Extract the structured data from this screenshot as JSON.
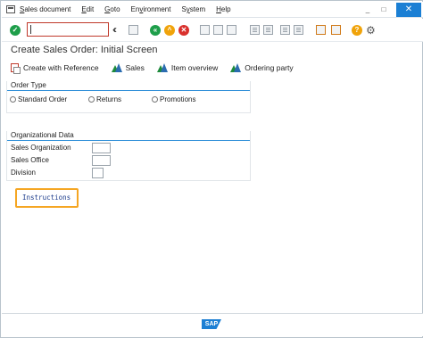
{
  "menubar": {
    "items": [
      "Sales document",
      "Edit",
      "Goto",
      "Environment",
      "System",
      "Help"
    ],
    "mnemonics": [
      "S",
      "E",
      "G",
      "v",
      "y",
      "H"
    ]
  },
  "window": {
    "minimize_glyph": "_",
    "restore_glyph": "□",
    "close_glyph": "✕"
  },
  "toolbar": {
    "command_value": "",
    "icons": [
      "enter-icon",
      "command-field",
      "back-arrows-icon",
      "save-icon",
      "back-icon",
      "exit-icon",
      "cancel-icon",
      "print-icon",
      "find-icon",
      "find-next-icon",
      "first-page-icon",
      "previous-page-icon",
      "next-page-icon",
      "last-page-icon",
      "new-session-icon",
      "shortcut-icon",
      "help-icon",
      "customize-icon"
    ]
  },
  "page": {
    "title": "Create Sales Order: Initial Screen"
  },
  "app_toolbar": {
    "create_with_reference": "Create with Reference",
    "sales": "Sales",
    "item_overview": "Item overview",
    "ordering_party": "Ordering party"
  },
  "order_type": {
    "title": "Order Type",
    "options": [
      "Standard Order",
      "Returns",
      "Promotions"
    ]
  },
  "org_data": {
    "title": "Organizational Data",
    "fields": [
      "Sales Organization",
      "Sales Office",
      "Division"
    ],
    "values": [
      "",
      "",
      ""
    ]
  },
  "instructions": {
    "label": "Instructions"
  },
  "status": {
    "logo": "SAP"
  },
  "colors": {
    "accent": "#1b7fd4",
    "ok_green": "#1e9e4a",
    "nav_orange": "#f0a30a",
    "cancel_red": "#d9302c",
    "highlight": "#f5a623"
  }
}
